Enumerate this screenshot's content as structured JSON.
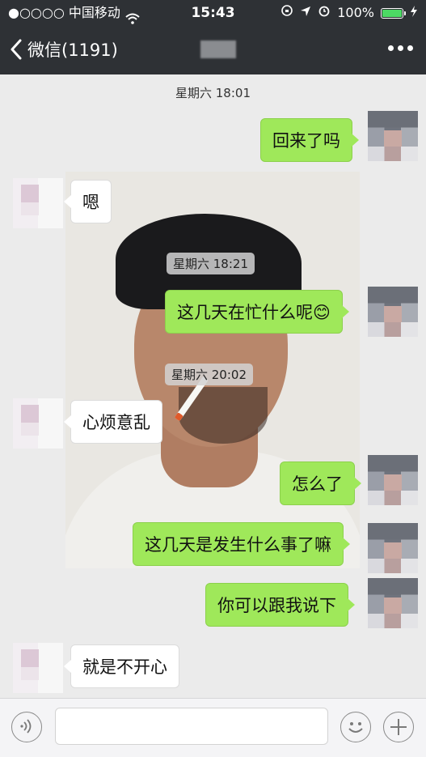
{
  "status_bar": {
    "carrier": "●○○○○ 中国移动",
    "time": "15:43",
    "battery_percent": "100%",
    "battery_level": 1.0
  },
  "nav": {
    "back_label": "微信(1191)"
  },
  "messages": [
    {
      "kind": "timestamp",
      "text": "星期六 18:01"
    },
    {
      "kind": "out",
      "text": "回来了吗"
    },
    {
      "kind": "in",
      "text": "嗯"
    },
    {
      "kind": "timestamp",
      "text": "星期六 18:21"
    },
    {
      "kind": "out",
      "text": "这几天在忙什么呢"
    },
    {
      "kind": "timestamp",
      "text": "星期六 20:02"
    },
    {
      "kind": "in",
      "text": "心烦意乱"
    },
    {
      "kind": "out",
      "text": "怎么了"
    },
    {
      "kind": "out",
      "text": "这几天是发生什么事了嘛"
    },
    {
      "kind": "out",
      "text": "你可以跟我说下"
    },
    {
      "kind": "in",
      "text": "就是不开心"
    }
  ],
  "emoji_in_message": "😊",
  "colors": {
    "header_bg": "#2e3135",
    "chat_bg": "#ebebeb",
    "outgoing_bubble": "#9fe85a",
    "incoming_bubble": "#ffffff",
    "battery_fill": "#4cd964"
  }
}
